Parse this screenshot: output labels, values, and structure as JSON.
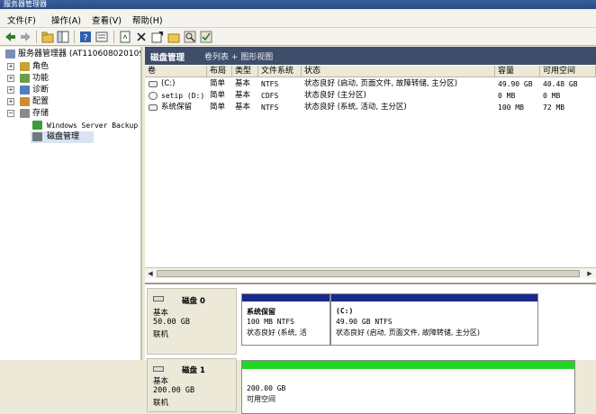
{
  "window": {
    "title": "服务器管理器"
  },
  "menu": {
    "file": "文件(F)",
    "action": "操作(A)",
    "view": "查看(V)",
    "help": "帮助(H)"
  },
  "tree": {
    "root": "服务器管理器 (AT1106080201095",
    "roles": "角色",
    "features": "功能",
    "diagnostics": "诊断",
    "configuration": "配置",
    "storage": "存储",
    "backup": "Windows Server Backup",
    "disk_mgmt": "磁盘管理"
  },
  "header": {
    "title": "磁盘管理",
    "subtitle": "卷列表 + 图形视图"
  },
  "columns": [
    "卷",
    "布局",
    "类型",
    "文件系统",
    "状态",
    "容量",
    "可用空间"
  ],
  "volumes": [
    {
      "name": "(C:)",
      "layout": "简单",
      "type": "基本",
      "fs": "NTFS",
      "status": "状态良好 (启动, 页面文件, 故障转储, 主分区)",
      "capacity": "49.90 GB",
      "free": "40.48 GB"
    },
    {
      "name": "setip (D:)",
      "layout": "简单",
      "type": "基本",
      "fs": "CDFS",
      "status": "状态良好 (主分区)",
      "capacity": "0 MB",
      "free": "0 MB"
    },
    {
      "name": "系统保留",
      "layout": "简单",
      "type": "基本",
      "fs": "NTFS",
      "status": "状态良好 (系统, 活动, 主分区)",
      "capacity": "100 MB",
      "free": "72 MB"
    }
  ],
  "disks": [
    {
      "name": "磁盘 0",
      "type": "基本",
      "size": "50.00 GB",
      "state": "联机",
      "partitions": [
        {
          "title": "系统保留",
          "info": "100 MB NTFS",
          "status": "状态良好 (系统, 活"
        },
        {
          "title": "(C:)",
          "info": "49.90 GB NTFS",
          "status": "状态良好 (启动, 页面文件, 故障转储, 主分区)"
        }
      ]
    },
    {
      "name": "磁盘 1",
      "type": "基本",
      "size": "200.00 GB",
      "state": "联机",
      "partitions": [
        {
          "title": "",
          "info": "200.00 GB",
          "status": "可用空间"
        }
      ]
    }
  ],
  "colors": {
    "primary_partition": "#1a2a8c",
    "unallocated": "#22d626",
    "header_bar": "#3d4d6a"
  }
}
